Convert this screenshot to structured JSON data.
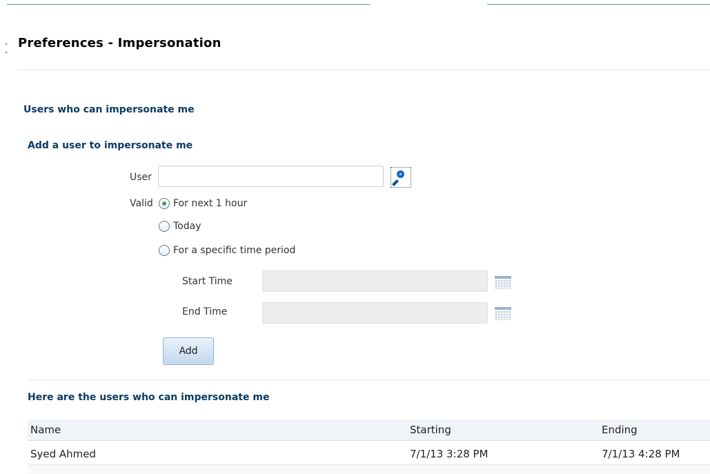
{
  "page": {
    "title": "Preferences - Impersonation"
  },
  "section": {
    "heading": "Users who can impersonate me"
  },
  "add_form": {
    "heading": "Add a user to impersonate me",
    "user_label": "User",
    "user_value": "",
    "search_icon": "magnifier-icon",
    "valid_label": "Valid",
    "options": [
      {
        "label": "For next 1 hour",
        "selected": true
      },
      {
        "label": "Today",
        "selected": false
      },
      {
        "label": "For a specific time period",
        "selected": false
      }
    ],
    "start_time_label": "Start Time",
    "start_time_value": "",
    "end_time_label": "End Time",
    "end_time_value": "",
    "calendar_icon": "calendar-icon",
    "add_button": "Add"
  },
  "users_table": {
    "heading": "Here are the users who can impersonate me",
    "columns": [
      "Name",
      "Starting",
      "Ending"
    ],
    "rows": [
      {
        "name": "Syed Ahmed",
        "starting": "7/1/13 3:28 PM",
        "ending": "7/1/13 4:28 PM"
      }
    ]
  },
  "colors": {
    "heading": "#0b3b63",
    "accent": "#1565c8",
    "selected_radio": "#3fa34d"
  }
}
